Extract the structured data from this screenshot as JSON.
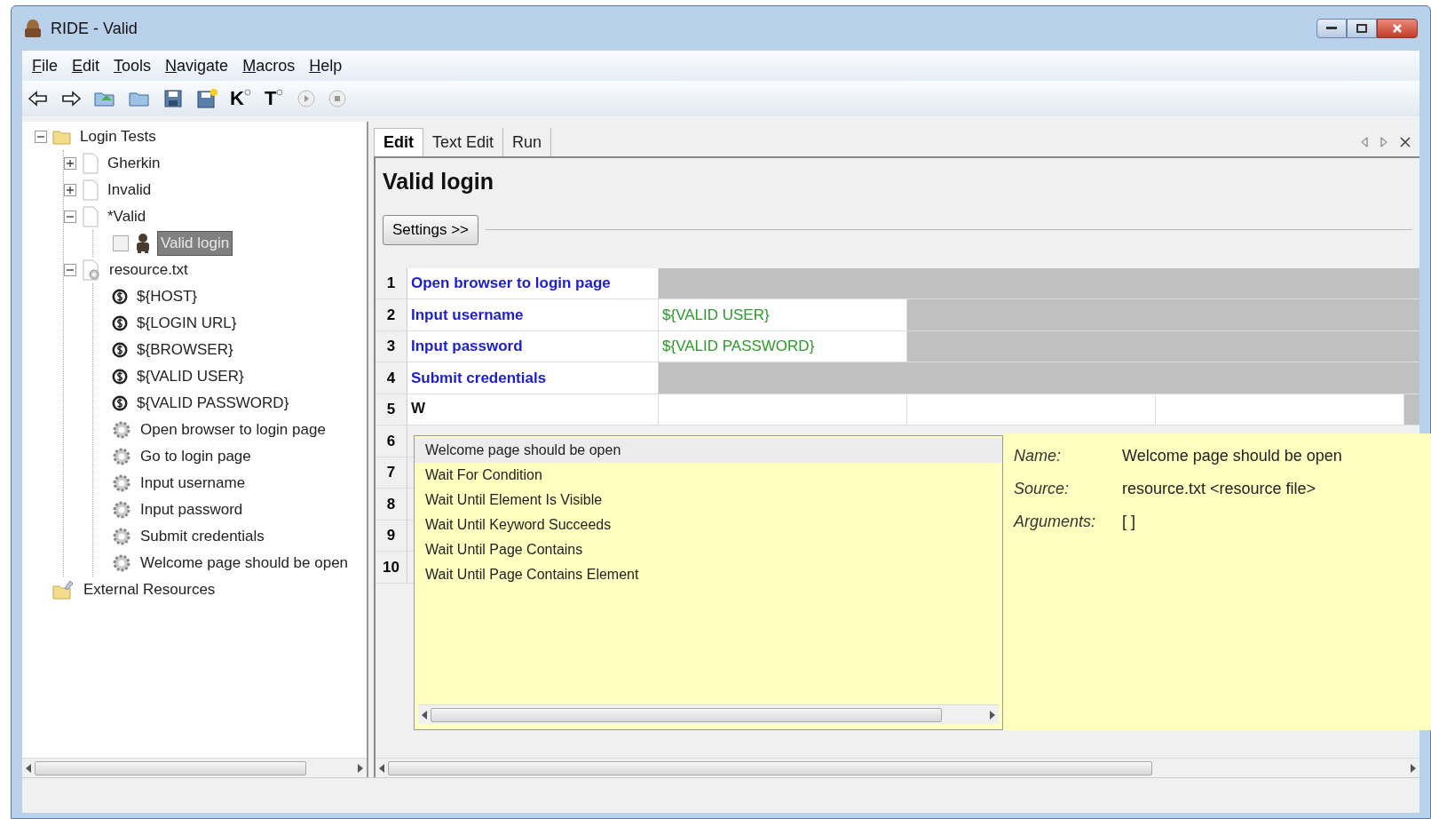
{
  "window": {
    "title": "RIDE - Valid"
  },
  "menu": [
    "File",
    "Edit",
    "Tools",
    "Navigate",
    "Macros",
    "Help"
  ],
  "toolbar": [
    {
      "kind": "back"
    },
    {
      "kind": "forward"
    },
    {
      "kind": "open-suite"
    },
    {
      "kind": "open-folder"
    },
    {
      "kind": "save"
    },
    {
      "kind": "save-all"
    },
    {
      "kind": "search",
      "label": "K"
    },
    {
      "kind": "search",
      "label": "T"
    },
    {
      "kind": "run"
    },
    {
      "kind": "stop"
    }
  ],
  "tree": [
    {
      "label": "Login Tests",
      "kind": "folder",
      "expanded": true,
      "selected": false,
      "children": [
        {
          "label": "Gherkin",
          "kind": "file",
          "expanded": false,
          "selected": false
        },
        {
          "label": "Invalid",
          "kind": "file",
          "expanded": false,
          "selected": false
        },
        {
          "label": "*Valid",
          "kind": "file",
          "expanded": true,
          "selected": false,
          "children": [
            {
              "label": "Valid login",
              "kind": "test",
              "checked": false,
              "selected": true
            }
          ]
        },
        {
          "label": "resource.txt",
          "kind": "resource",
          "expanded": true,
          "selected": false,
          "children": [
            {
              "label": "${HOST}",
              "kind": "variable",
              "selected": false
            },
            {
              "label": "${LOGIN URL}",
              "kind": "variable",
              "selected": false
            },
            {
              "label": "${BROWSER}",
              "kind": "variable",
              "selected": false
            },
            {
              "label": "${VALID USER}",
              "kind": "variable",
              "selected": false
            },
            {
              "label": "${VALID PASSWORD}",
              "kind": "variable",
              "selected": false
            },
            {
              "label": "Open browser to login page",
              "kind": "keyword",
              "selected": false
            },
            {
              "label": "Go to login page",
              "kind": "keyword",
              "selected": false
            },
            {
              "label": "Input username",
              "kind": "keyword",
              "selected": false
            },
            {
              "label": "Input password",
              "kind": "keyword",
              "selected": false
            },
            {
              "label": "Submit credentials",
              "kind": "keyword",
              "selected": false
            },
            {
              "label": "Welcome page should be open",
              "kind": "keyword",
              "selected": false
            }
          ]
        }
      ]
    },
    {
      "label": "External Resources",
      "kind": "external",
      "selected": false
    }
  ],
  "tabs": [
    {
      "label": "Edit",
      "selected": true
    },
    {
      "label": "Text Edit",
      "selected": false
    },
    {
      "label": "Run",
      "selected": false
    }
  ],
  "editor": {
    "title": "Valid login",
    "settings_button": "Settings >>",
    "rows": [
      {
        "number": "1",
        "cells": [
          {
            "kind": "keyword",
            "text": "Open browser to login page"
          }
        ]
      },
      {
        "number": "2",
        "cells": [
          {
            "kind": "keyword",
            "text": "Input username"
          },
          {
            "kind": "argument",
            "text": "${VALID USER}"
          }
        ]
      },
      {
        "number": "3",
        "cells": [
          {
            "kind": "keyword",
            "text": "Input password"
          },
          {
            "kind": "argument",
            "text": "${VALID PASSWORD}"
          }
        ]
      },
      {
        "number": "4",
        "cells": [
          {
            "kind": "keyword",
            "text": "Submit credentials"
          }
        ]
      },
      {
        "number": "5",
        "cells": [
          {
            "kind": "editing",
            "text": "W"
          },
          {
            "kind": "empty"
          },
          {
            "kind": "empty"
          },
          {
            "kind": "empty"
          }
        ]
      },
      {
        "number": "6",
        "cells": []
      },
      {
        "number": "7",
        "cells": []
      },
      {
        "number": "8",
        "cells": []
      },
      {
        "number": "9",
        "cells": []
      },
      {
        "number": "10",
        "cells": []
      }
    ]
  },
  "autocomplete": {
    "suggestions": [
      {
        "label": "Welcome page should be open",
        "selected": true
      },
      {
        "label": "Wait For Condition",
        "selected": false
      },
      {
        "label": "Wait Until Element Is Visible",
        "selected": false
      },
      {
        "label": "Wait Until Keyword Succeeds",
        "selected": false
      },
      {
        "label": "Wait Until Page Contains",
        "selected": false
      },
      {
        "label": "Wait Until Page Contains Element",
        "selected": false
      }
    ],
    "details": [
      {
        "label": "Name:",
        "value": "Welcome page should be open"
      },
      {
        "label": "Source:",
        "value": "resource.txt <resource file>"
      },
      {
        "label": "Arguments:",
        "value": "[ ]"
      }
    ]
  }
}
